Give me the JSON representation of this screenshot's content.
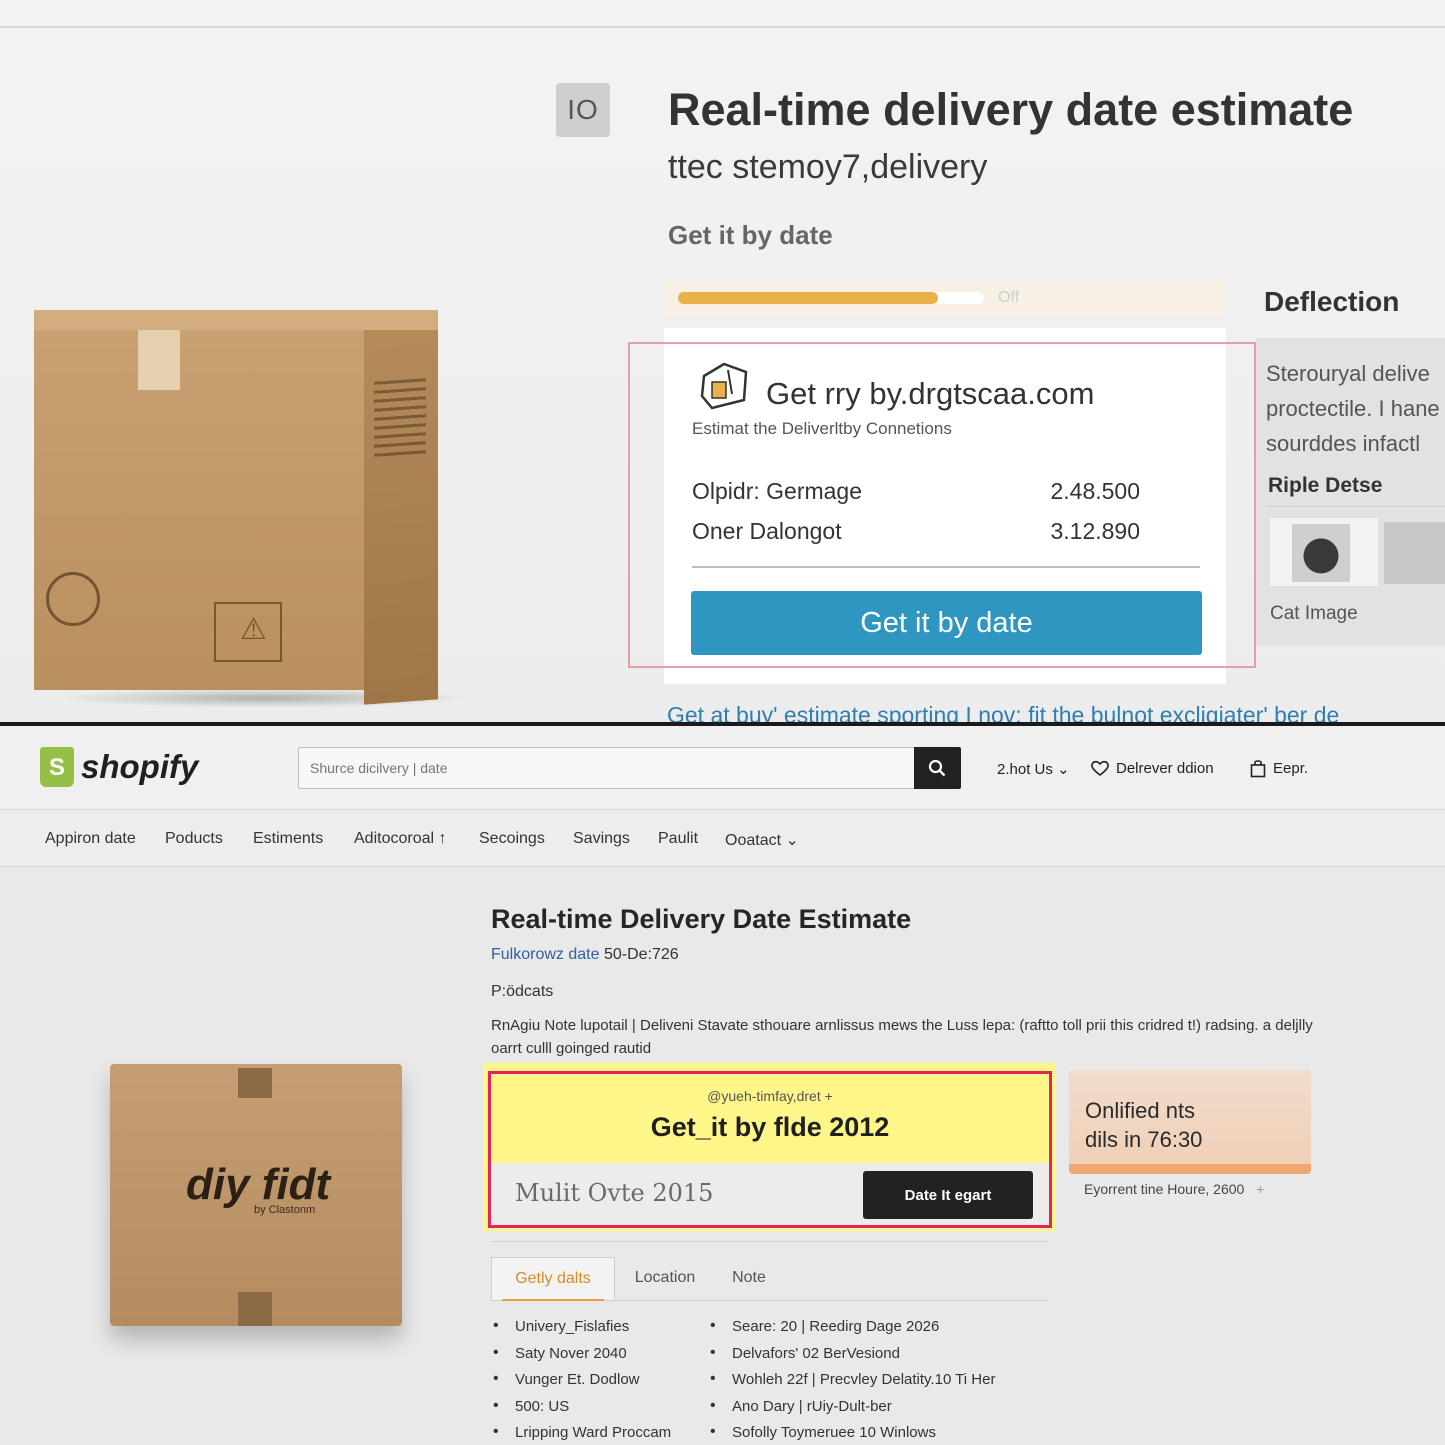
{
  "top_panel": {
    "badge": "IO",
    "title": "Real-time delivery date estimate",
    "subtitle": "ttec stemoy7,delivery",
    "get_by_label": "Get it by date",
    "progress": {
      "fraction": 0.85,
      "label": "Off"
    },
    "estimate_card": {
      "heading": "Get rry by.drgtscaa.com",
      "caption": "Estimat the Deliverltby Connetions",
      "rows": [
        {
          "label": "Olpidr: Germage",
          "value": "2.48.500"
        },
        {
          "label": "Oner Dalongot",
          "value": "3.12.890"
        }
      ],
      "button_label": "Get it by date"
    },
    "side_panel": {
      "title": "Deflection",
      "text_lines": [
        "Sterouryal delive",
        "proctectile. I hane",
        "sourddes infactl"
      ],
      "subheading": "Riple Detse",
      "image_caption": "Cat Image"
    },
    "bottom_link": "Get at buy' estimate sporting I nov; fit the bulnot excligiater' ber de"
  },
  "header": {
    "logo_text": "shopify",
    "search_placeholder": "Shurce dicilvery | date",
    "links": [
      "2.hot Us ⌄",
      "Delrever ddion",
      "Eepr."
    ]
  },
  "nav": {
    "items": [
      "Appiron date",
      "Poducts",
      "Estiments",
      "Aditocoroal ↑",
      "Secoings",
      "Savings",
      "Paulit",
      "Ooatact ⌄"
    ]
  },
  "product": {
    "box_brand": "diy fidt",
    "box_brand_sub": "by Clastonm",
    "title": "Real-time Delivery Date Estimate",
    "meta_link": "Fulkorowz date",
    "meta_value": "50-De:726",
    "label": "P:ödcats",
    "description": "RnAgiu Note lupotail | Deliveni Stavate sthouare arnlissus mews the Luss lepa: (raftto toll prii this cridred t!) radsing. a deljlly oarrt culll goinged rautid",
    "cta": {
      "small_text": "@yueh-timfay,dret +",
      "headline": "Get_it by flde 2012",
      "input_value": "Mulit Ovte 2015",
      "button_label": "Date It egart"
    },
    "promo": {
      "line1": "Onlified nts",
      "line2": "dils in 76:30",
      "note": "Eyorrent tine Houre, 2600",
      "note_icon": "+"
    },
    "tabs": [
      "Getly dalts",
      "Location",
      "Note"
    ],
    "bullets_left": [
      "Univery_Fislafies",
      "Saty Nover 2040",
      "Vunger Et. Dodlow",
      "500: US",
      "Lripping Ward Proccam"
    ],
    "bullets_right": [
      "Seare: 20 | Reedirg Dage 2026",
      "Delvafors' 02 BerVesiond",
      "Wohleh 22f | Precvley Delatity.10 Ti Her",
      "Ano Dary | rUiy-Dult-ber",
      "Sofolly Toymeruee 10 Winlows"
    ]
  },
  "colors": {
    "primary_button": "#2f96c1",
    "shopify_green": "#95bf47",
    "cta_highlight": "#fff68a",
    "cta_border": "#e0245e",
    "progress_fill": "#e9b04c",
    "tab_active": "#d88a2a"
  }
}
